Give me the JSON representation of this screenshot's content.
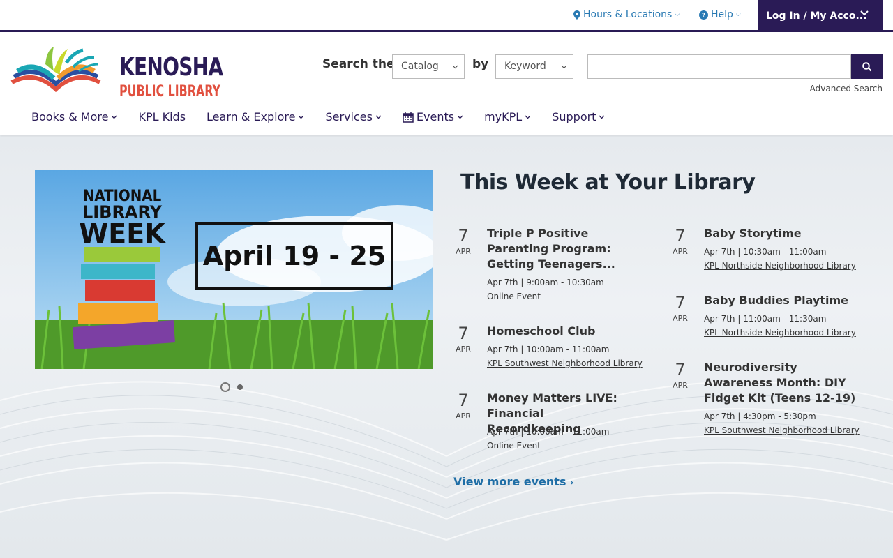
{
  "utility": {
    "hours_label": "Hours & Locations",
    "help_label": "Help",
    "login_label": "Log In / My Acco..."
  },
  "logo": {
    "line1": "KENOSHA",
    "line2": "PUBLIC LIBRARY"
  },
  "search": {
    "search_the_label": "Search the",
    "scope_value": "Catalog",
    "by_label": "by",
    "type_value": "Keyword",
    "input_value": "",
    "advanced_label": "Advanced Search"
  },
  "nav": {
    "items": [
      {
        "label": "Books & More",
        "has_menu": true
      },
      {
        "label": "KPL Kids",
        "has_menu": false
      },
      {
        "label": "Learn & Explore",
        "has_menu": true
      },
      {
        "label": "Services",
        "has_menu": true
      },
      {
        "label": "Events",
        "has_menu": true,
        "icon": "calendar-icon"
      },
      {
        "label": "myKPL",
        "has_menu": true
      },
      {
        "label": "Support",
        "has_menu": true
      }
    ]
  },
  "banner": {
    "line1": "NATIONAL",
    "line2": "LIBRARY",
    "line3": "WEEK",
    "dates": "April 19 - 25",
    "slide_count": 2,
    "active_slide": 1
  },
  "events_section": {
    "title": "This Week at Your Library",
    "left_column": [
      {
        "day": "7",
        "month": "APR",
        "title": "Triple P Positive Parenting Program: Getting Teenagers...",
        "time": "Apr 7th | 9:00am - 10:30am",
        "location": "Online Event",
        "location_is_link": false
      },
      {
        "day": "7",
        "month": "APR",
        "title": "Homeschool Club",
        "time": "Apr 7th | 10:00am - 11:00am",
        "location": "KPL Southwest Neighborhood Library",
        "location_is_link": true
      },
      {
        "day": "7",
        "month": "APR",
        "title": "Money Matters LIVE: Financial Recordkeeping",
        "time": "Apr 7th | 10:00am - 11:00am",
        "location": "Online Event",
        "location_is_link": false
      }
    ],
    "right_column": [
      {
        "day": "7",
        "month": "APR",
        "title": "Baby Storytime",
        "time": "Apr 7th | 10:30am - 11:00am",
        "location": "KPL Northside Neighborhood Library",
        "location_is_link": true
      },
      {
        "day": "7",
        "month": "APR",
        "title": "Baby Buddies Playtime",
        "time": "Apr 7th | 11:00am - 11:30am",
        "location": "KPL Northside Neighborhood Library",
        "location_is_link": true
      },
      {
        "day": "7",
        "month": "APR",
        "title": "Neurodiversity Awareness Month: DIY Fidget Kit (Teens 12-19)",
        "time": "Apr 7th | 4:30pm - 5:30pm",
        "location": "KPL Southwest Neighborhood Library",
        "location_is_link": true
      }
    ],
    "view_more_label": "View more events"
  },
  "colors": {
    "brand_purple": "#2a1b56",
    "link_blue": "#2a7ab3",
    "logo_red": "#e1503f"
  }
}
